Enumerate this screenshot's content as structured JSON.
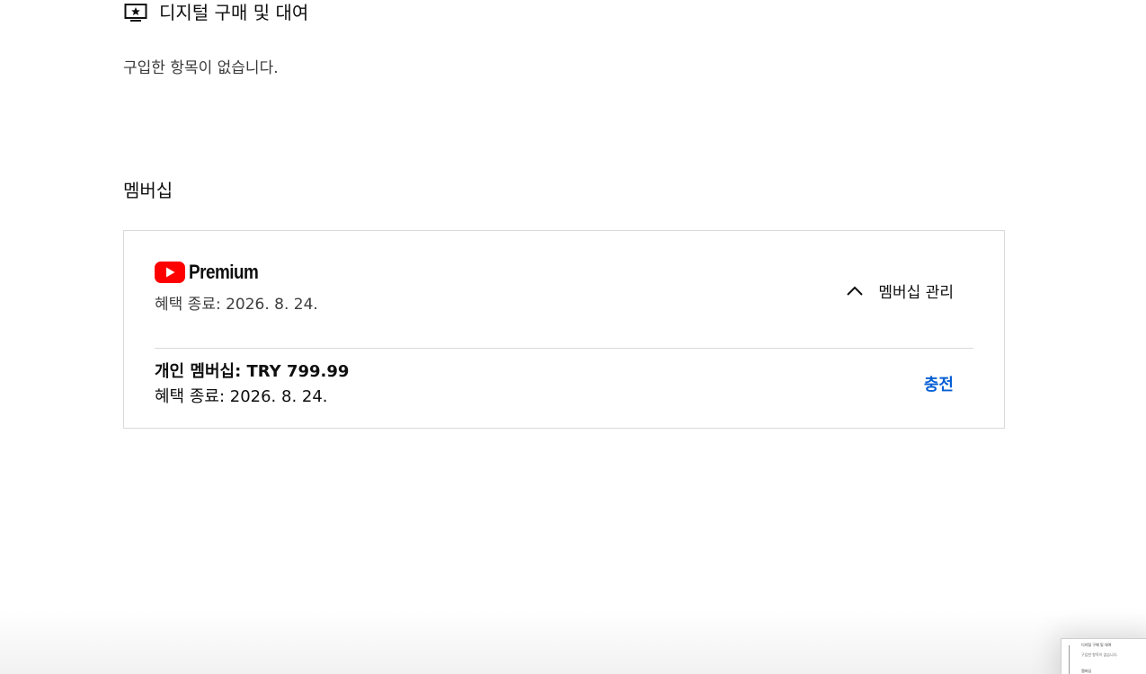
{
  "digital_section": {
    "title": "디지털 구매 및 대여",
    "icon": "tv-star-icon",
    "empty_message": "구입한 항목이 없습니다."
  },
  "membership_section": {
    "heading": "멤버십",
    "card": {
      "brand": "Premium",
      "brand_icon": "youtube-play-icon",
      "brand_color": "#ff0000",
      "benefit_end_top": "혜택 종료: 2026. 8. 24.",
      "manage_label": "멤버십 관리",
      "manage_icon": "chevron-up-icon",
      "plan": "개인 멤버십: TRY 799.99",
      "benefit_end_bottom": "혜택 종료: 2026. 8. 24.",
      "charge_label": "충전",
      "link_color": "#065fd4"
    }
  },
  "thumbnail": {
    "title": "디지털 구매 및 대여",
    "empty_message": "구입한 항목이 없습니다.",
    "heading": "멤버십"
  }
}
